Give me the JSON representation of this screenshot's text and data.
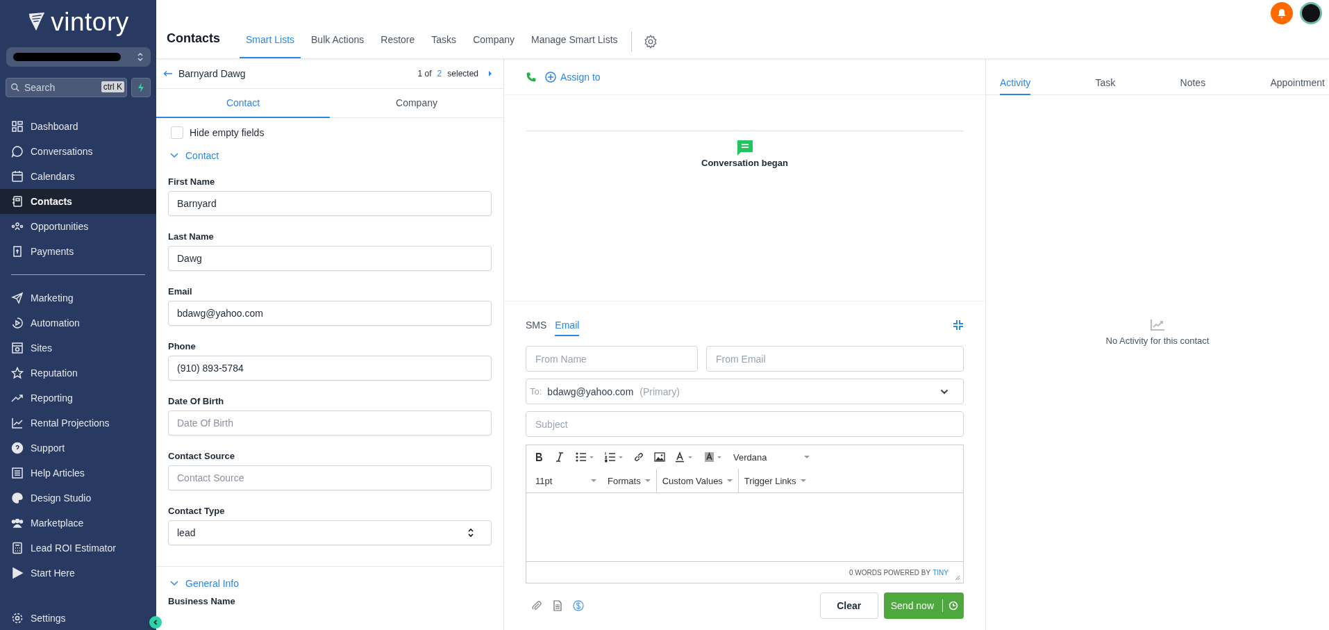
{
  "sidebar": {
    "logo": "vintory",
    "search": {
      "placeholder": "Search",
      "shortcut": "ctrl K"
    },
    "items": [
      {
        "label": "Dashboard",
        "selected": false
      },
      {
        "label": "Conversations",
        "selected": false
      },
      {
        "label": "Calendars",
        "selected": false
      },
      {
        "label": "Contacts",
        "selected": true
      },
      {
        "label": "Opportunities",
        "selected": false
      },
      {
        "label": "Payments",
        "selected": false
      }
    ],
    "items_2": [
      {
        "label": "Marketing",
        "selected": false
      },
      {
        "label": "Automation",
        "selected": false
      },
      {
        "label": "Sites",
        "selected": false
      },
      {
        "label": "Reputation",
        "selected": false
      },
      {
        "label": "Reporting",
        "selected": false
      },
      {
        "label": "Rental Projections",
        "selected": false
      },
      {
        "label": "Support",
        "selected": false
      },
      {
        "label": "Help Articles",
        "selected": false
      },
      {
        "label": "Design Studio",
        "selected": false
      },
      {
        "label": "Marketplace",
        "selected": false
      },
      {
        "label": "Lead ROI Estimator",
        "selected": false
      },
      {
        "label": "Start Here",
        "selected": false
      }
    ],
    "footer": {
      "label": "Settings"
    }
  },
  "header": {
    "title": "Contacts",
    "tabs": [
      {
        "label": "Smart Lists",
        "selected": true
      },
      {
        "label": "Bulk Actions",
        "selected": false
      },
      {
        "label": "Restore",
        "selected": false
      },
      {
        "label": "Tasks",
        "selected": false
      },
      {
        "label": "Company",
        "selected": false
      },
      {
        "label": "Manage Smart Lists",
        "selected": false
      }
    ]
  },
  "contact_panel": {
    "name": "Barnyard Dawg",
    "pager": {
      "current": "1 of",
      "total": "2",
      "suffix": "selected"
    },
    "tabs": [
      {
        "label": "Contact",
        "selected": true
      },
      {
        "label": "Company",
        "selected": false
      }
    ],
    "hide_empty": {
      "label": "Hide empty fields",
      "checked": false
    },
    "section": {
      "label": "Contact",
      "expanded": true
    },
    "fields": [
      {
        "label": "First Name",
        "kind": "text",
        "value": "Barnyard"
      },
      {
        "label": "Last Name",
        "kind": "text",
        "value": "Dawg"
      },
      {
        "label": "Email",
        "kind": "text",
        "value": "bdawg@yahoo.com"
      },
      {
        "label": "Phone",
        "kind": "text",
        "value": "(910) 893-5784"
      },
      {
        "label": "Date Of Birth",
        "kind": "text",
        "placeholder": "Date Of Birth"
      },
      {
        "label": "Contact Source",
        "kind": "text",
        "placeholder": "Contact Source"
      },
      {
        "label": "Contact Type",
        "kind": "select",
        "value": "lead"
      }
    ],
    "section_2": {
      "label": "General Info",
      "expanded": true
    },
    "next_label": "Business Name"
  },
  "conversation": {
    "assign": "Assign to",
    "event": "Conversation began",
    "composer": {
      "channels": [
        {
          "label": "SMS",
          "selected": false
        },
        {
          "label": "Email",
          "selected": true
        }
      ],
      "from_name": {
        "placeholder": "From Name"
      },
      "from_email": {
        "placeholder": "From Email"
      },
      "to": {
        "label": "To:",
        "value": "bdawg@yahoo.com",
        "tag": "(Primary)"
      },
      "subject": {
        "placeholder": "Subject"
      },
      "toolbar": {
        "font": "Verdana",
        "size": "11pt",
        "menus": [
          "Formats",
          "Custom Values",
          "Trigger Links"
        ]
      },
      "status": "0 WORDS POWERED BY",
      "status_link": "TINY",
      "buttons": {
        "clear": "Clear",
        "send": "Send now"
      }
    }
  },
  "activity": {
    "tabs": [
      {
        "label": "Activity",
        "selected": true
      },
      {
        "label": "Task",
        "selected": false
      },
      {
        "label": "Notes",
        "selected": false
      },
      {
        "label": "Appointment",
        "selected": false
      }
    ],
    "empty": "No Activity for this contact"
  }
}
